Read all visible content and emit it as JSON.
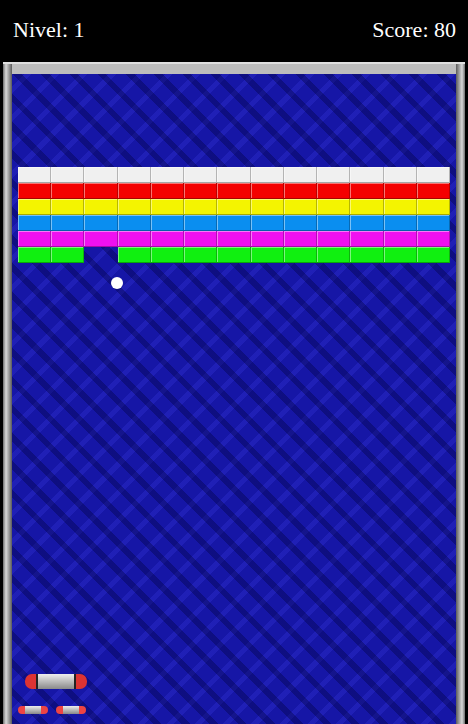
{
  "hud": {
    "level": "Nivel: 1",
    "score": "Score: 80"
  },
  "bricks": [
    {
      "color": "#f0f0f0",
      "items": [
        {
          "present": true
        },
        {
          "present": true
        },
        {
          "present": true
        },
        {
          "present": true
        },
        {
          "present": true
        },
        {
          "present": true
        },
        {
          "present": true
        },
        {
          "present": true
        },
        {
          "present": true
        },
        {
          "present": true
        },
        {
          "present": true
        },
        {
          "present": true
        },
        {
          "present": true
        }
      ]
    },
    {
      "color": "#f40000",
      "items": [
        {
          "present": true
        },
        {
          "present": true
        },
        {
          "present": true
        },
        {
          "present": true
        },
        {
          "present": true
        },
        {
          "present": true
        },
        {
          "present": true
        },
        {
          "present": true
        },
        {
          "present": true
        },
        {
          "present": true
        },
        {
          "present": true
        },
        {
          "present": true
        },
        {
          "present": true
        }
      ]
    },
    {
      "color": "#f4f400",
      "items": [
        {
          "present": true
        },
        {
          "present": true
        },
        {
          "present": true
        },
        {
          "present": true
        },
        {
          "present": true
        },
        {
          "present": true
        },
        {
          "present": true
        },
        {
          "present": true
        },
        {
          "present": true
        },
        {
          "present": true
        },
        {
          "present": true
        },
        {
          "present": true
        },
        {
          "present": true
        }
      ]
    },
    {
      "color": "#0a8ef0",
      "items": [
        {
          "present": true
        },
        {
          "present": true
        },
        {
          "present": true
        },
        {
          "present": true
        },
        {
          "present": true
        },
        {
          "present": true
        },
        {
          "present": true
        },
        {
          "present": true
        },
        {
          "present": true
        },
        {
          "present": true
        },
        {
          "present": true
        },
        {
          "present": true
        },
        {
          "present": true
        }
      ]
    },
    {
      "color": "#f010f0",
      "items": [
        {
          "present": true
        },
        {
          "present": true
        },
        {
          "present": true
        },
        {
          "present": true
        },
        {
          "present": true
        },
        {
          "present": true
        },
        {
          "present": true
        },
        {
          "present": true
        },
        {
          "present": true
        },
        {
          "present": true
        },
        {
          "present": true
        },
        {
          "present": true
        },
        {
          "present": true
        }
      ]
    },
    {
      "color": "#10f010",
      "items": [
        {
          "present": true
        },
        {
          "present": true
        },
        {
          "present": false
        },
        {
          "present": true
        },
        {
          "present": true
        },
        {
          "present": true
        },
        {
          "present": true
        },
        {
          "present": true
        },
        {
          "present": true
        },
        {
          "present": true
        },
        {
          "present": true
        },
        {
          "present": true
        },
        {
          "present": true
        }
      ]
    }
  ],
  "lives": 2
}
